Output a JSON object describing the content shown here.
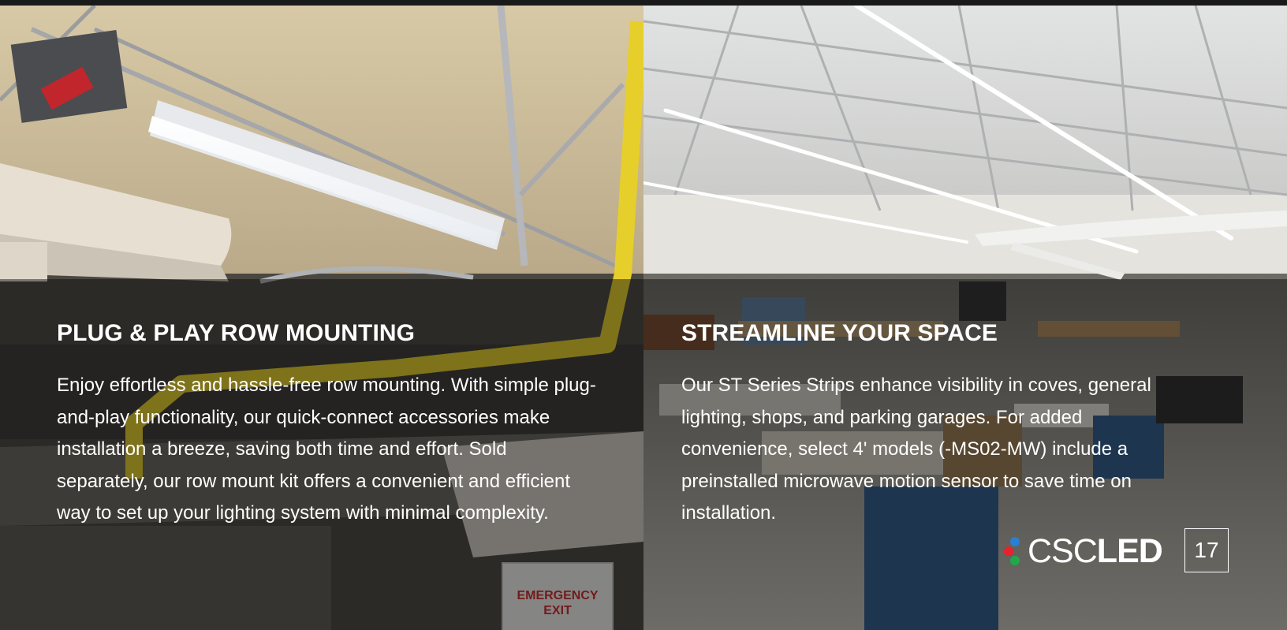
{
  "left_panel": {
    "heading": "PLUG & PLAY ROW MOUNTING",
    "body": "Enjoy effortless and hassle-free row mounting. With simple plug-and-play functionality, our quick-connect accessories make installation a breeze, saving both time and effort. Sold separately, our row mount kit offers a convenient and efficient way to set up your lighting system with minimal complexity.",
    "photo_signs": {
      "exit_sign_line1": "EMERGENCY",
      "exit_sign_line2": "EXIT"
    }
  },
  "right_panel": {
    "heading": "STREAMLINE YOUR SPACE",
    "body": "Our ST Series Strips enhance visibility in coves, general lighting, shops, and parking garages. For added convenience, select 4' models (-MS02-MW) include a preinstalled microwave motion sensor to save time on installation."
  },
  "footer": {
    "logo_light": "CSC",
    "logo_bold": "LED",
    "page_number": "17"
  },
  "colors": {
    "logo_blue": "#2a7fd4",
    "logo_red": "#e8212c",
    "logo_green": "#22a84a",
    "text": "#ffffff"
  }
}
